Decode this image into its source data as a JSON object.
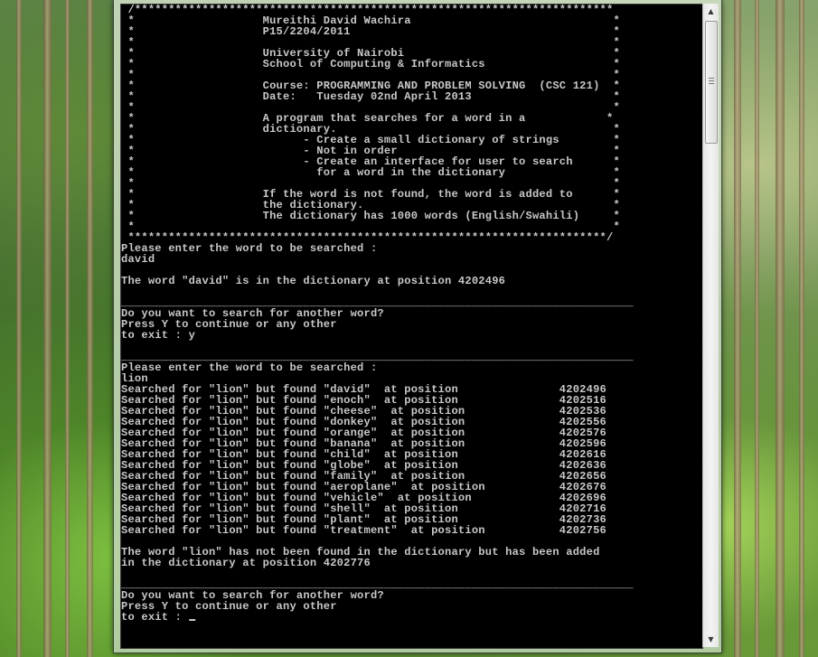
{
  "console": {
    "lines": [
      " /***********************************************************************",
      " *                   Mureithi David Wachira                              *",
      " *                   P15/2204/2011                                       *",
      " *                                                                       *",
      " *                   University of Nairobi                               *",
      " *                   School of Computing & Informatics                   *",
      " *                                                                       *",
      " *                   Course: PROGRAMMING AND PROBLEM SOLVING  (CSC 121)  *",
      " *                   Date:   Tuesday 02nd April 2013                     *",
      " *                                                                       *",
      " *                   A program that searches for a word in a            *",
      " *                   dictionary.                                         *",
      " *                         - Create a small dictionary of strings        *",
      " *                         - Not in order                                *",
      " *                         - Create an interface for user to search      *",
      " *                           for a word in the dictionary                *",
      " *                                                                       *",
      " *                   If the word is not found, the word is added to      *",
      " *                   the dictionary.                                     *",
      " *                   The dictionary has 1000 words (English/Swahili)     *",
      " *                                                                       *",
      " ***********************************************************************/",
      "Please enter the word to be searched :",
      "david",
      "",
      "The word \"david\" is in the dictionary at position 4202496",
      "",
      "____________________________________________________________________________",
      "Do you want to search for another word?",
      "Press Y to continue or any other",
      "to exit : y",
      "",
      "____________________________________________________________________________",
      "Please enter the word to be searched :",
      "lion",
      "Searched for \"lion\" but found \"david\"  at position               4202496",
      "Searched for \"lion\" but found \"enoch\"  at position               4202516",
      "Searched for \"lion\" but found \"cheese\"  at position              4202536",
      "Searched for \"lion\" but found \"donkey\"  at position              4202556",
      "Searched for \"lion\" but found \"orange\"  at position              4202576",
      "Searched for \"lion\" but found \"banana\"  at position              4202596",
      "Searched for \"lion\" but found \"child\"  at position               4202616",
      "Searched for \"lion\" but found \"globe\"  at position               4202636",
      "Searched for \"lion\" but found \"family\"  at position              4202656",
      "Searched for \"lion\" but found \"aeroplane\"  at position           4202676",
      "Searched for \"lion\" but found \"vehicle\"  at position             4202696",
      "Searched for \"lion\" but found \"shell\"  at position               4202716",
      "Searched for \"lion\" but found \"plant\"  at position               4202736",
      "Searched for \"lion\" but found \"treatment\"  at position           4202756",
      "",
      "The word \"lion\" has not been found in the dictionary but has been added",
      "in the dictionary at position 4202776",
      "",
      "____________________________________________________________________________",
      "Do you want to search for another word?",
      "Press Y to continue or any other",
      "to exit : "
    ]
  },
  "scrollbar": {
    "up_icon": "scroll-up-arrow-icon",
    "down_icon": "scroll-down-arrow-icon",
    "up_glyph": "▲",
    "down_glyph": "▼"
  },
  "colors": {
    "console_bg": "#000000",
    "console_text": "#c8c8c8"
  }
}
